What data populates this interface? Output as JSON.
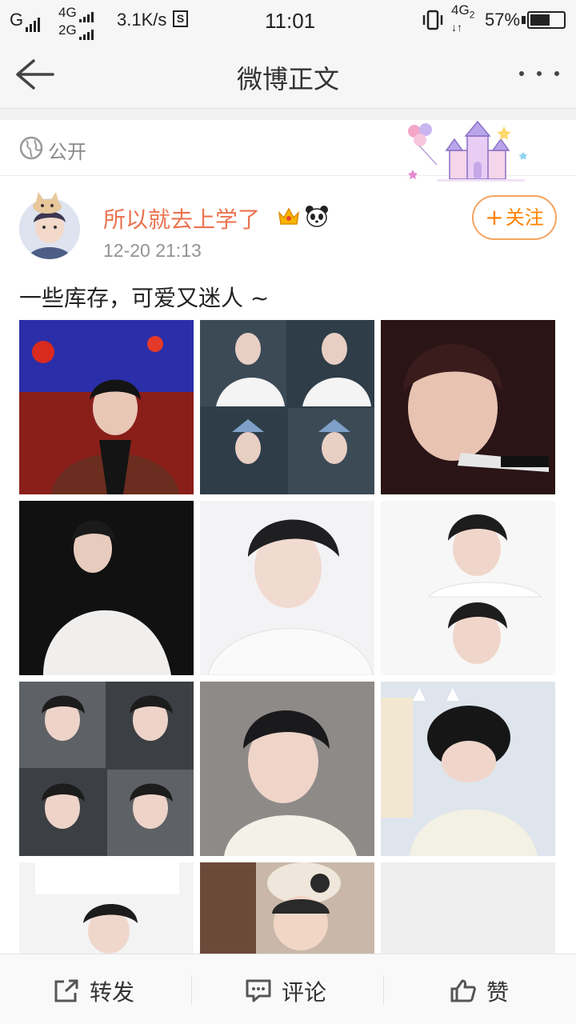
{
  "status_bar": {
    "carrier1": "G",
    "net_top": "4G",
    "net_bottom": "2G",
    "speed": "3.1K/s",
    "s_icon": "S",
    "time": "11:01",
    "net2": "4G",
    "net2_sub": "2",
    "battery": "57%",
    "battery_level": 0.57
  },
  "header": {
    "title": "微博正文",
    "back_icon": "back-arrow-icon",
    "more_icon": "more-dots-icon"
  },
  "visibility": {
    "label": "公开",
    "icon": "globe-icon"
  },
  "post": {
    "username": "所以就去上学了",
    "timestamp": "12-20 21:13",
    "follow_label": "关注",
    "follow_plus": "+",
    "text": "一些库存，可爱又迷人 ~",
    "badges": [
      "crown-icon",
      "panda-icon"
    ],
    "images": [
      {
        "name": "photo-1",
        "bg": "#8a1f1a"
      },
      {
        "name": "photo-2",
        "bg": "#2e3d48"
      },
      {
        "name": "photo-3",
        "bg": "#2a1416"
      },
      {
        "name": "photo-4",
        "bg": "#111111"
      },
      {
        "name": "photo-5",
        "bg": "#f3f3f5"
      },
      {
        "name": "photo-6",
        "bg": "#f7f7f7"
      },
      {
        "name": "photo-7",
        "bg": "#3c3f44"
      },
      {
        "name": "photo-8",
        "bg": "#8d8a88"
      },
      {
        "name": "photo-9",
        "bg": "#dfe5ec"
      },
      {
        "name": "photo-10",
        "bg": "#f3f3f3"
      },
      {
        "name": "photo-11",
        "bg": "#c9b8a9"
      },
      {
        "name": "photo-12",
        "bg": "#efefef"
      }
    ]
  },
  "toolbar": {
    "repost_label": "转发",
    "comment_label": "评论",
    "like_label": "赞"
  },
  "colors": {
    "username": "#eb7350",
    "follow": "#ff8200",
    "muted": "#939393"
  }
}
